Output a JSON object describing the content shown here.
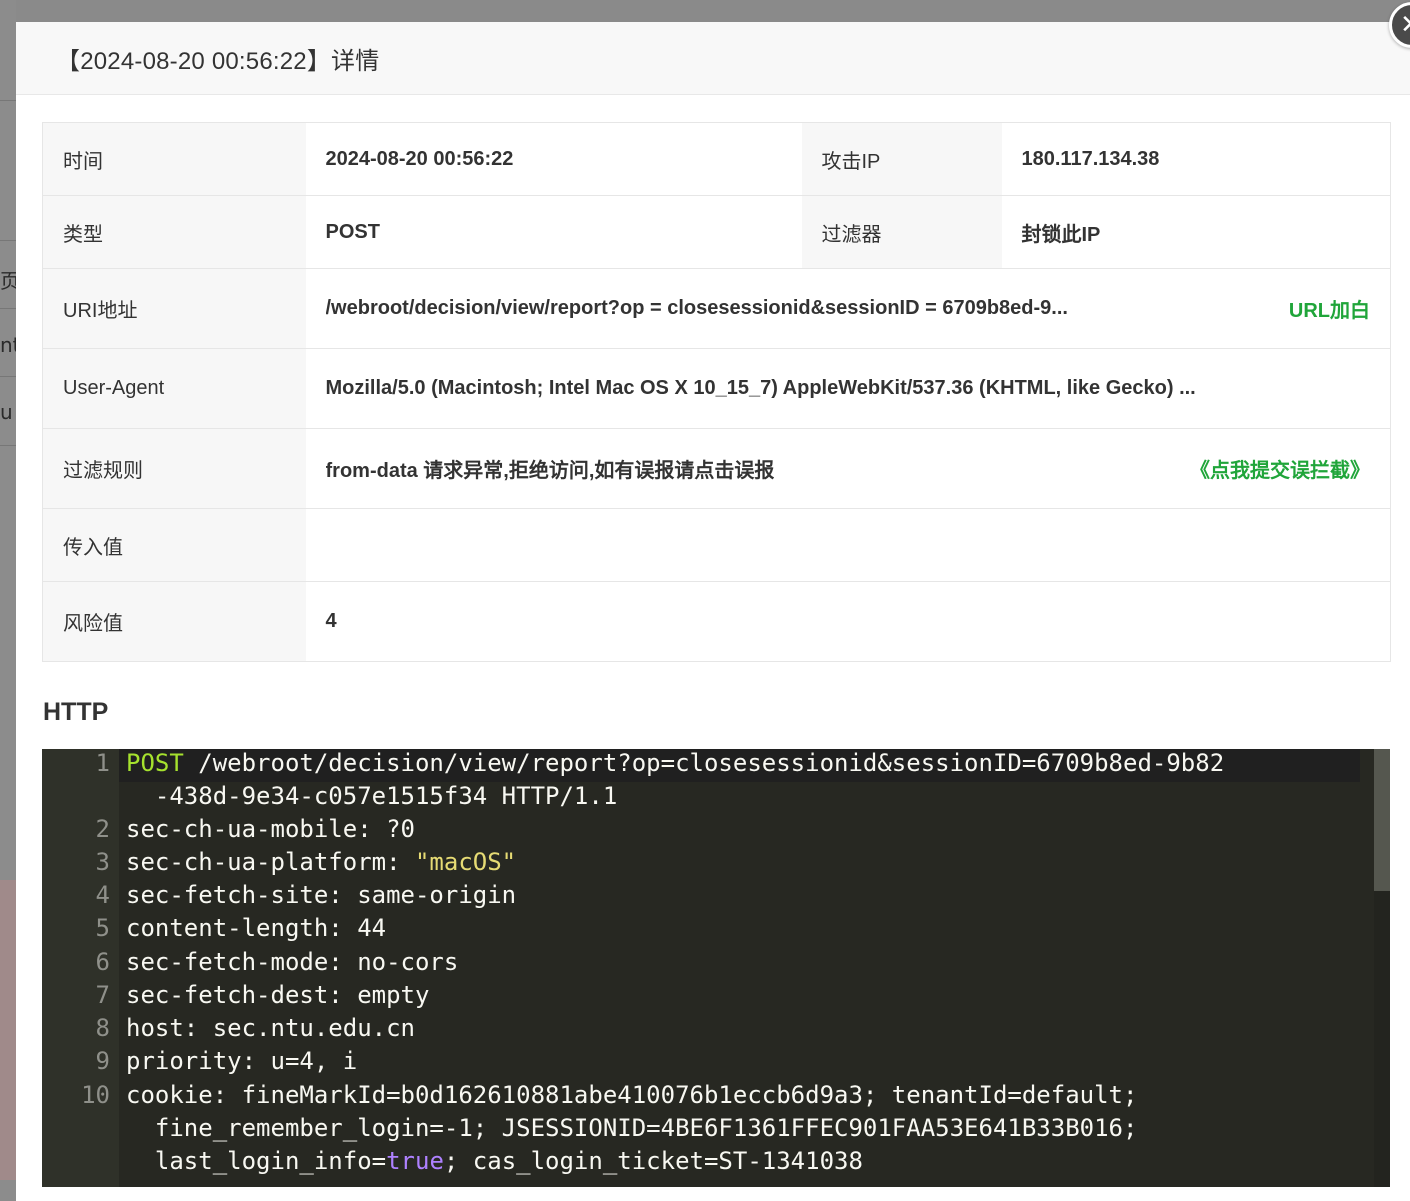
{
  "modal": {
    "title": "【2024-08-20 00:56:22】详情",
    "close_icon": "close-icon"
  },
  "background": {
    "letters": [
      "页",
      "nt",
      "u"
    ]
  },
  "info": {
    "time_label": "时间",
    "time_value": "2024-08-20 00:56:22",
    "attack_ip_label": "攻击IP",
    "attack_ip_value": "180.117.134.38",
    "type_label": "类型",
    "type_value": "POST",
    "filter_label": "过滤器",
    "filter_value": "封锁此IP",
    "uri_label": "URI地址",
    "uri_value": "/webroot/decision/view/report?op = closesessionid&sessionID = 6709b8ed-9...",
    "uri_whitelist": "URL加白",
    "ua_label": "User-Agent",
    "ua_value": "Mozilla/5.0 (Macintosh; Intel Mac OS X 10_15_7) AppleWebKit/537.36 (KHTML, like Gecko) ...",
    "rule_label": "过滤规则",
    "rule_value": "from-data 请求异常,拒绝访问,如有误报请点击误报",
    "rule_report": "《点我提交误拦截》",
    "input_label": "传入值",
    "input_value": "",
    "risk_label": "风险值",
    "risk_value": "4"
  },
  "http": {
    "title": "HTTP",
    "lines": [
      {
        "no": "1",
        "method": "POST",
        "rest": " /webroot/decision/view/report?op=closesessionid&sessionID=6709b8ed-9b82",
        "cont": "  -438d-9e34-c057e1515f34 HTTP/1.1"
      },
      {
        "no": "2",
        "text": "sec-ch-ua-mobile: ?0"
      },
      {
        "no": "3",
        "key": "sec-ch-ua-platform: ",
        "str": "\"macOS\""
      },
      {
        "no": "4",
        "text": "sec-fetch-site: same-origin"
      },
      {
        "no": "5",
        "text": "content-length: 44"
      },
      {
        "no": "6",
        "text": "sec-fetch-mode: no-cors"
      },
      {
        "no": "7",
        "text": "sec-fetch-dest: empty"
      },
      {
        "no": "8",
        "text": "host: sec.ntu.edu.cn"
      },
      {
        "no": "9",
        "text": "priority: u=4, i"
      },
      {
        "no": "10",
        "text": "cookie: fineMarkId=b0d162610881abe410076b1eccb6d9a3; tenantId=default;",
        "cont": "  fine_remember_login=-1; JSESSIONID=4BE6F1361FFEC901FAA53E641B33B016;",
        "cont2a": "  last_login_info=",
        "cont2b": "true",
        "cont2c": "; cas_login_ticket=ST-1341038"
      }
    ]
  },
  "colors": {
    "accent_green": "#20a53a",
    "code_bg": "#272822"
  }
}
